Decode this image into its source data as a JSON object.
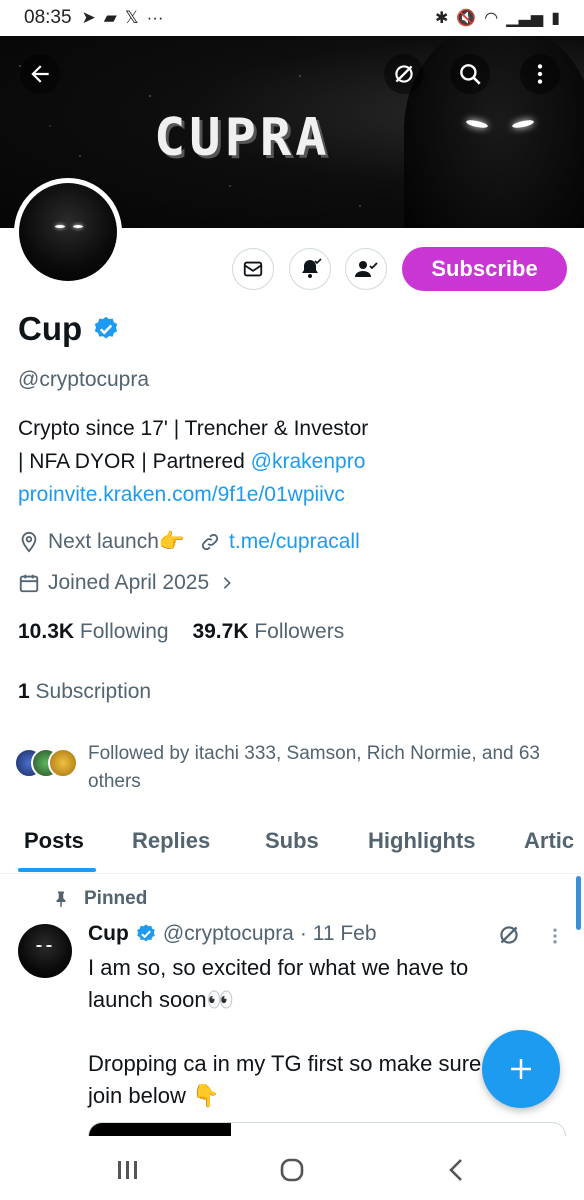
{
  "status_bar": {
    "time": "08:35"
  },
  "banner": {
    "title": "CUPRA"
  },
  "header_actions": {
    "back": "back-arrow-icon",
    "grok": "grok-icon",
    "search": "search-icon",
    "more": "more-vertical-icon"
  },
  "profile": {
    "name": "Cup",
    "handle": "@cryptocupra",
    "bio_line1": "Crypto since 17' | Trencher & Investor",
    "bio_line2_prefix": "| NFA DYOR | Partnered ",
    "bio_mention": "@krakenpro",
    "bio_link": "proinvite.kraken.com/9f1e/01wpiivc",
    "location": "Next launch👉",
    "website": "t.me/cupracall",
    "joined": "Joined April 2025",
    "following_count": "10.3K",
    "following_label": "Following",
    "followers_count": "39.7K",
    "followers_label": "Followers",
    "subscription_count": "1",
    "subscription_label": "Subscription",
    "followed_by": "Followed by itachi 333, Samson, Rich Normie, and 63 others",
    "subscribe_label": "Subscribe",
    "accent_color": "#1d9bf0",
    "subscribe_color": "#c936d4"
  },
  "tabs": [
    {
      "label": "Posts"
    },
    {
      "label": "Replies"
    },
    {
      "label": "Subs"
    },
    {
      "label": "Highlights"
    },
    {
      "label": "Artic"
    }
  ],
  "pinned_post": {
    "pinned_label": "Pinned",
    "author": "Cup",
    "handle": "@cryptocupra",
    "date": "· 11 Feb",
    "text": "I am so, so excited for what we have to launch soon👀\n\nDropping ca in my TG first so make sure you join below 👇"
  },
  "fab": {
    "label": "+"
  }
}
